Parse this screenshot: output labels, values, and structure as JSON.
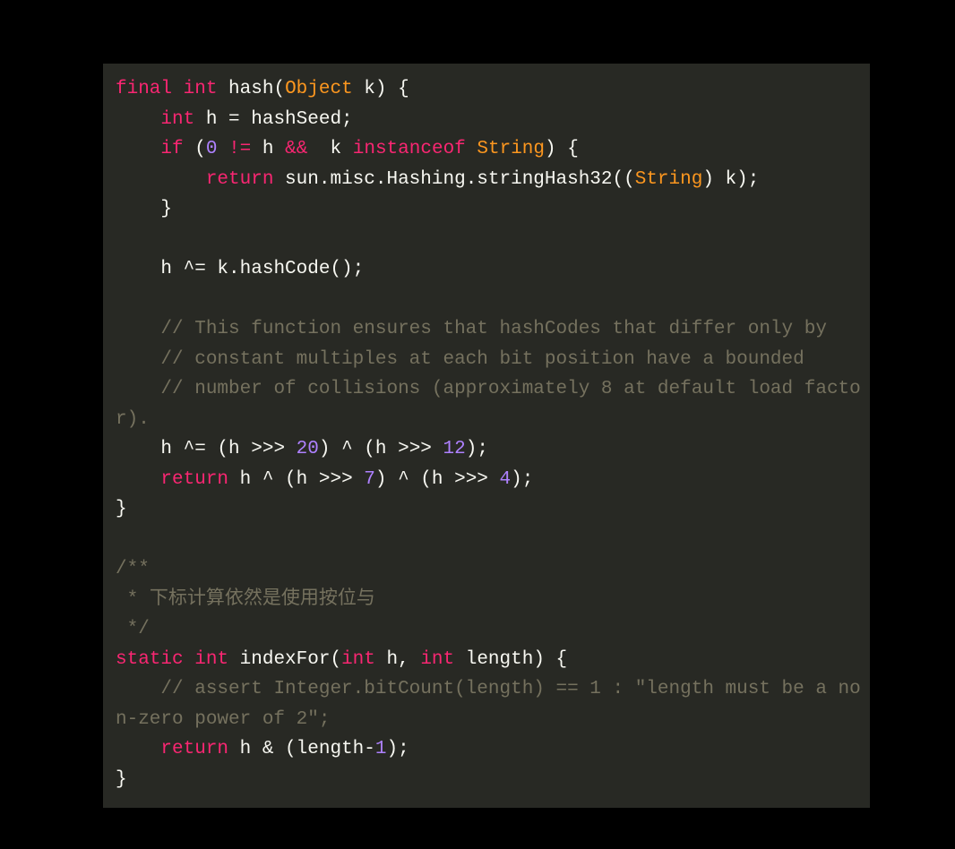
{
  "code": {
    "tokens": [
      [
        [
          "final",
          "kw"
        ],
        [
          " ",
          "pln"
        ],
        [
          "int",
          "kw"
        ],
        [
          " hash(",
          "pln"
        ],
        [
          "Object",
          "typ"
        ],
        [
          " k) {",
          "pln"
        ]
      ],
      [
        [
          "    ",
          "pln"
        ],
        [
          "int",
          "kw"
        ],
        [
          " h = hashSeed;",
          "pln"
        ]
      ],
      [
        [
          "    ",
          "pln"
        ],
        [
          "if",
          "kw"
        ],
        [
          " (",
          "pln"
        ],
        [
          "0",
          "num"
        ],
        [
          " ",
          "pln"
        ],
        [
          "!=",
          "kw"
        ],
        [
          " h ",
          "pln"
        ],
        [
          "&&",
          "kw"
        ],
        [
          "  k ",
          "pln"
        ],
        [
          "instanceof",
          "kw"
        ],
        [
          " ",
          "pln"
        ],
        [
          "String",
          "typ"
        ],
        [
          ") {",
          "pln"
        ]
      ],
      [
        [
          "        ",
          "pln"
        ],
        [
          "return",
          "kw"
        ],
        [
          " sun.misc.Hashing.stringHash32((",
          "pln"
        ],
        [
          "String",
          "typ"
        ],
        [
          ") k);",
          "pln"
        ]
      ],
      [
        [
          "    }",
          "pln"
        ]
      ],
      [
        [
          "",
          "pln"
        ]
      ],
      [
        [
          "    h ^= k.hashCode();",
          "pln"
        ]
      ],
      [
        [
          "",
          "pln"
        ]
      ],
      [
        [
          "    ",
          "pln"
        ],
        [
          "// This function ensures that hashCodes that differ only by",
          "cmt"
        ]
      ],
      [
        [
          "    ",
          "pln"
        ],
        [
          "// constant multiples at each bit position have a bounded",
          "cmt"
        ]
      ],
      [
        [
          "    ",
          "pln"
        ],
        [
          "// number of collisions (approximately 8 at default load factor).",
          "cmt"
        ]
      ],
      [
        [
          "    h ^= (h >>> ",
          "pln"
        ],
        [
          "20",
          "num"
        ],
        [
          ") ^ (h >>> ",
          "pln"
        ],
        [
          "12",
          "num"
        ],
        [
          ");",
          "pln"
        ]
      ],
      [
        [
          "    ",
          "pln"
        ],
        [
          "return",
          "kw"
        ],
        [
          " h ^ (h >>> ",
          "pln"
        ],
        [
          "7",
          "num"
        ],
        [
          ") ^ (h >>> ",
          "pln"
        ],
        [
          "4",
          "num"
        ],
        [
          ");",
          "pln"
        ]
      ],
      [
        [
          "}",
          "pln"
        ]
      ],
      [
        [
          "",
          "pln"
        ]
      ],
      [
        [
          "/**",
          "cmt"
        ]
      ],
      [
        [
          " * 下标计算依然是使用按位与",
          "cmt"
        ]
      ],
      [
        [
          " */",
          "cmt"
        ]
      ],
      [
        [
          "static",
          "kw"
        ],
        [
          " ",
          "pln"
        ],
        [
          "int",
          "kw"
        ],
        [
          " indexFor(",
          "pln"
        ],
        [
          "int",
          "kw"
        ],
        [
          " h, ",
          "pln"
        ],
        [
          "int",
          "kw"
        ],
        [
          " length) {",
          "pln"
        ]
      ],
      [
        [
          "    ",
          "pln"
        ],
        [
          "// assert Integer.bitCount(length) == 1 : \"length must be a non-zero power of 2\";",
          "cmt"
        ]
      ],
      [
        [
          "    ",
          "pln"
        ],
        [
          "return",
          "kw"
        ],
        [
          " h & (length-",
          "pln"
        ],
        [
          "1",
          "num"
        ],
        [
          ");",
          "pln"
        ]
      ],
      [
        [
          "}",
          "pln"
        ]
      ]
    ]
  }
}
